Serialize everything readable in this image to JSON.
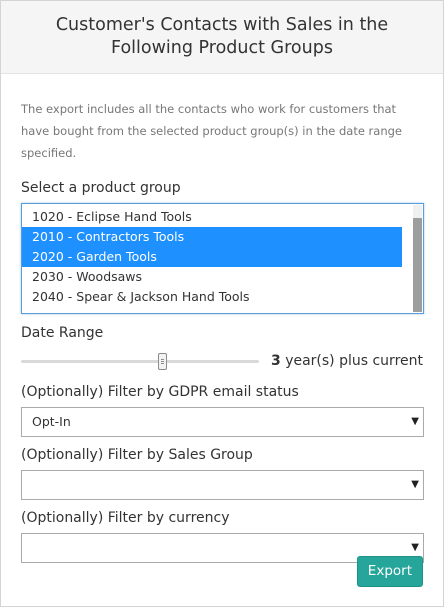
{
  "dialog": {
    "title": "Customer's Contacts with Sales in the Following Product Groups",
    "description": "The export includes all the contacts who work for customers that have bought from the selected product group(s) in the date range specified."
  },
  "product_group": {
    "label": "Select a product group",
    "options": [
      {
        "label": "1020 - Eclipse Hand Tools",
        "selected": false
      },
      {
        "label": "2010 - Contractors Tools",
        "selected": true
      },
      {
        "label": "2020 - Garden Tools",
        "selected": true
      },
      {
        "label": "2030 - Woodsaws",
        "selected": false
      },
      {
        "label": "2040 - Spear & Jackson Hand Tools",
        "selected": false
      }
    ]
  },
  "date_range": {
    "label": "Date Range",
    "value": "3",
    "suffix": "year(s) plus current",
    "slider_fraction": 0.6
  },
  "filters": {
    "gdpr": {
      "label": "(Optionally) Filter by GDPR email status",
      "value": "Opt-In"
    },
    "sales_group": {
      "label": "(Optionally) Filter by Sales Group",
      "value": ""
    },
    "currency": {
      "label": "(Optionally) Filter by currency",
      "value": ""
    }
  },
  "icons": {
    "dropdown_arrow": "▼"
  },
  "colors": {
    "selection": "#1e90ff",
    "export_button": "#26a69a"
  },
  "actions": {
    "export_label": "Export"
  }
}
